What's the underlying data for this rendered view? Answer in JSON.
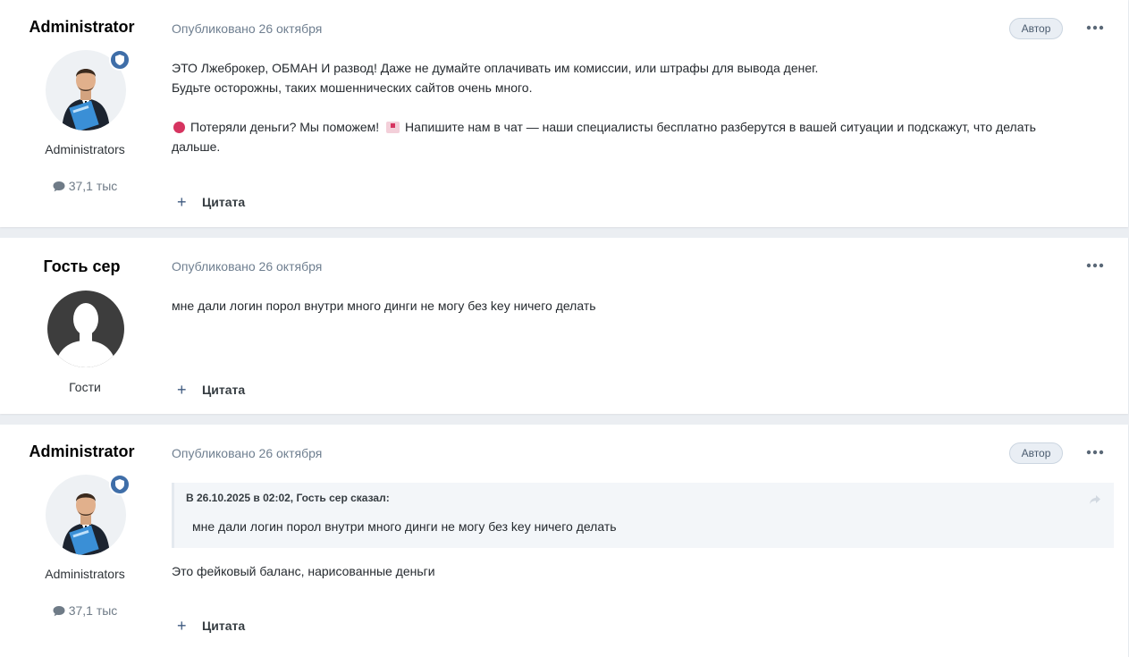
{
  "posts": [
    {
      "author": "Administrator",
      "group": "Administrators",
      "post_count": "37,1 тыс",
      "published": "Опубликовано 26 октября",
      "author_tag": "Автор",
      "lines": [
        "ЭТО Лжеброкер, ОБМАН И развод! Даже не думайте оплачивать им комиссии, или штрафы для вывода денег.",
        "Будьте осторожны, таких мошеннических сайтов очень много."
      ],
      "promo_part1": "Потеряли деньги? Мы поможем!",
      "promo_part2": "Напишите нам в чат  — наши специалисты бесплатно разберутся в вашей ситуации и подскажут, что делать",
      "promo_part3": "дальше.",
      "quote_label": "Цитата"
    },
    {
      "author": "Гость сер",
      "group": "Гости",
      "published": "Опубликовано 26 октября",
      "text": "мне дали логин порол внутри много динги  не могу без key ничего делать",
      "quote_label": "Цитата"
    },
    {
      "author": "Administrator",
      "group": "Administrators",
      "post_count": "37,1 тыс",
      "published": "Опубликовано 26 октября",
      "author_tag": "Автор",
      "quote_cite": "В 26.10.2025 в 02:02, Гость сер сказал:",
      "quote_text": "мне дали логин порол внутри много динги  не могу без key ничего делать",
      "text": "Это фейковый баланс, нарисованные деньги",
      "quote_label": "Цитата"
    }
  ],
  "colors": {
    "page_bg": "#ebeef2",
    "card_bg": "#ffffff",
    "badge_blue": "#3f6ea8",
    "meta_gray": "#6f7f90"
  },
  "icons": [
    "shield-icon",
    "comment-icon",
    "more-icon",
    "plus-icon",
    "share-icon",
    "red-circle-icon",
    "inbox-icon"
  ]
}
